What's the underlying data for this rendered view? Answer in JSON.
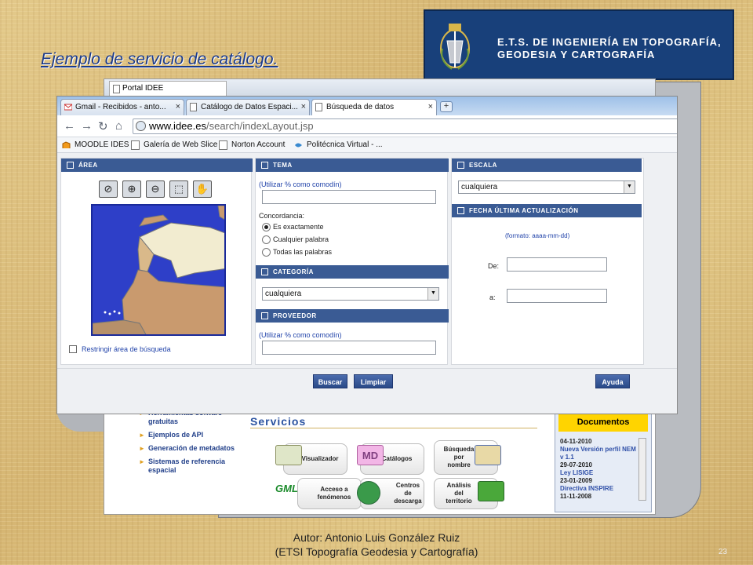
{
  "slide": {
    "title": "Ejemplo de servicio de catálogo.",
    "banner_line1": "E.T.S. DE INGENIERÍA EN TOPOGRAFÍA,",
    "banner_line2": "GEODESIA Y CARTOGRAFÍA",
    "footer_line1": "Autor:  Antonio Luis González Ruiz",
    "footer_line2": "(ETSI Topografía Geodesia y Cartografía)",
    "slide_number": "23"
  },
  "portal": {
    "tab_title": "Portal IDEE",
    "sidebar": [
      "Herramientas sofware gratuitas",
      "Ejemplos de API",
      "Generación de metadatos",
      "Sistemas de referencia espacial"
    ],
    "services_heading": "Servicios",
    "services": [
      {
        "icon": "map-thumb",
        "label": "Visualizador"
      },
      {
        "icon": "MD",
        "label": "Catálogos"
      },
      {
        "icon": "search-thumb",
        "label": "Búsqueda por nombre"
      },
      {
        "icon": "GML",
        "label": "Acceso a fenómenos"
      },
      {
        "icon": "globe-thumb",
        "label": "Centros de descarga"
      },
      {
        "icon": "analysis-thumb",
        "label": "Análisis del territorio"
      }
    ],
    "docs_title": "Documentos",
    "docs": [
      {
        "date": "04-11-2010",
        "text": "Nueva Versión perfil NEM v 1.1"
      },
      {
        "date": "29-07-2010",
        "text": "Ley LISIGE"
      },
      {
        "date": "23-01-2009",
        "text": "Directiva INSPIRE"
      },
      {
        "date": "11-11-2008",
        "text": ""
      }
    ]
  },
  "browser": {
    "tabs": [
      {
        "title": "Gmail - Recibidos - anto...",
        "active": false
      },
      {
        "title": "Catálogo de Datos Espaci...",
        "active": false
      },
      {
        "title": "Búsqueda de datos",
        "active": true
      }
    ],
    "url_host": "www.idee.es",
    "url_path": "/search/indexLayout.jsp",
    "bookmarks": [
      "MOODLE IDES",
      "Galería de Web Slice",
      "Norton Account",
      "Politécnica Virtual - ..."
    ]
  },
  "form": {
    "area": {
      "header": "ÁREA",
      "restrict_label": "Restringir área de búsqueda"
    },
    "tema": {
      "header": "TEMA",
      "hint": "(Utilizar % como comodín)",
      "value": "",
      "match_label": "Concordancia:",
      "options": [
        "Es exactamente",
        "Cualquier palabra",
        "Todas las palabras"
      ],
      "selected_index": 0
    },
    "categoria": {
      "header": "CATEGORÍA",
      "selected": "cualquiera"
    },
    "proveedor": {
      "header": "PROVEEDOR",
      "hint": "(Utilizar % como comodín)",
      "value": ""
    },
    "escala": {
      "header": "ESCALA",
      "selected": "cualquiera"
    },
    "fecha": {
      "header": "FECHA ÚLTIMA ACTUALIZACIÓN",
      "format_hint": "(formato: aaaa-mm-dd)",
      "from_label": "De:",
      "to_label": "a:",
      "from_value": "",
      "to_value": ""
    },
    "buttons": {
      "search": "Buscar",
      "clear": "Limpiar",
      "help": "Ayuda"
    }
  }
}
